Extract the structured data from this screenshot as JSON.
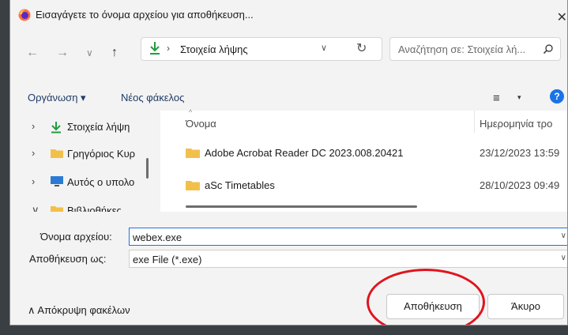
{
  "window": {
    "title": "Εισαγάγετε το όνομα αρχείου για αποθήκευση...",
    "close_glyph": "✕"
  },
  "address_bar": {
    "back_glyph": "←",
    "forward_glyph": "→",
    "recent_glyph": "∨",
    "up_glyph": "↑",
    "separator": "›",
    "location": "Στοιχεία λήψης",
    "dropdown_glyph": "∨",
    "refresh_glyph": "↻"
  },
  "search": {
    "placeholder": "Αναζήτηση σε: Στοιχεία λή..."
  },
  "toolbar": {
    "organize_label": "Οργάνωση ▾",
    "new_folder_label": "Νέος φάκελος",
    "view_glyph": "≡",
    "view_dropdown_glyph": "▾",
    "help_glyph": "?"
  },
  "nav_pane": {
    "items": [
      {
        "label": "Στοιχεία λήψη",
        "chevron": "›"
      },
      {
        "label": "Γρηγόριος Κυρ",
        "chevron": "›"
      },
      {
        "label": "Αυτός ο υπολο",
        "chevron": "›"
      },
      {
        "label": "Βιβλιοθήκες",
        "chevron": "∨"
      }
    ]
  },
  "file_list": {
    "sort_glyph": "^",
    "columns": {
      "name": "Όνομα",
      "date": "Ημερομηνία τρο"
    },
    "rows": [
      {
        "name": "Adobe Acrobat Reader DC 2023.008.20421",
        "date": "23/12/2023 13:59"
      },
      {
        "name": "aSc Timetables",
        "date": "28/10/2023 09:49"
      }
    ]
  },
  "form": {
    "filename_label": "Όνομα αρχείου:",
    "filename_value": "webex.exe",
    "savetype_label": "Αποθήκευση ως:",
    "savetype_value": "exe File (*.exe)",
    "dropdown_glyph": "∨"
  },
  "footer": {
    "hide_folders_label": "∧  Απόκρυψη φακέλων",
    "save_label": "Αποθήκευση",
    "cancel_label": "Άκυρο"
  },
  "colors": {
    "accent": "#1a73e8",
    "folder": "#f2c04a",
    "download_arrow": "#1f9e3f",
    "annotation": "#e0141e"
  }
}
